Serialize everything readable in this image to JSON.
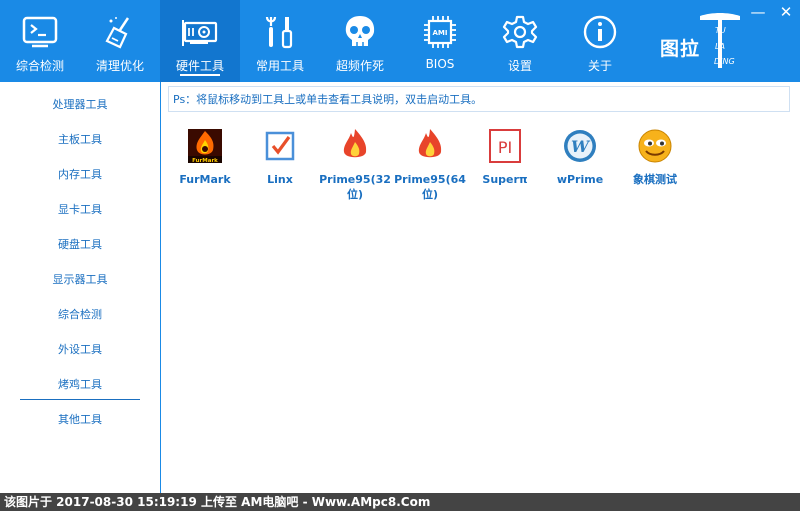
{
  "nav": {
    "items": [
      {
        "label": "综合检测",
        "icon": "monitor-terminal-icon"
      },
      {
        "label": "清理优化",
        "icon": "broom-icon"
      },
      {
        "label": "硬件工具",
        "icon": "graphics-card-icon"
      },
      {
        "label": "常用工具",
        "icon": "tools-icon"
      },
      {
        "label": "超频作死",
        "icon": "skull-icon"
      },
      {
        "label": "BIOS",
        "icon": "bios-chip-icon"
      },
      {
        "label": "设置",
        "icon": "gear-icon"
      },
      {
        "label": "关于",
        "icon": "info-icon"
      }
    ],
    "active_index": 2
  },
  "brand": {
    "text": "图拉",
    "tu": "TU",
    "la": "LA",
    "ding": "DING",
    "chip_text": "AMI"
  },
  "window": {
    "minimize": "—",
    "close": "✕"
  },
  "sidebar": {
    "items": [
      "处理器工具",
      "主板工具",
      "内存工具",
      "显卡工具",
      "硬盘工具",
      "显示器工具",
      "综合检测",
      "外设工具",
      "烤鸡工具",
      "其他工具"
    ],
    "active_index": 8
  },
  "content": {
    "tip": "Ps：将鼠标移动到工具上或单击查看工具说明，双击启动工具。",
    "tools": [
      {
        "name": "FurMark",
        "icon": "furmark-icon",
        "icon_text": "FurMark"
      },
      {
        "name": "Linx",
        "icon": "linx-checkbox-icon"
      },
      {
        "name": "Prime95(32位)",
        "line1": "Prime95(32",
        "line2": "位)",
        "icon": "prime95-flame-icon"
      },
      {
        "name": "Prime95(64位)",
        "line1": "Prime95(64",
        "line2": "位)",
        "icon": "prime95-flame-icon"
      },
      {
        "name": "Superπ",
        "icon": "superpi-icon",
        "icon_text": "PI"
      },
      {
        "name": "wPrime",
        "icon": "wprime-icon",
        "icon_text": "W"
      },
      {
        "name": "象棋测试",
        "icon": "chess-smiley-icon"
      }
    ]
  },
  "footer": {
    "text": "该图片于 2017-08-30 15:19:19 上传至 AM电脑吧 - Www.AMpc8.Com"
  },
  "colors": {
    "accent": "#1a8ae6",
    "active_tab": "#1276cf",
    "link": "#1a6fc0",
    "footer_bg": "#444444"
  }
}
